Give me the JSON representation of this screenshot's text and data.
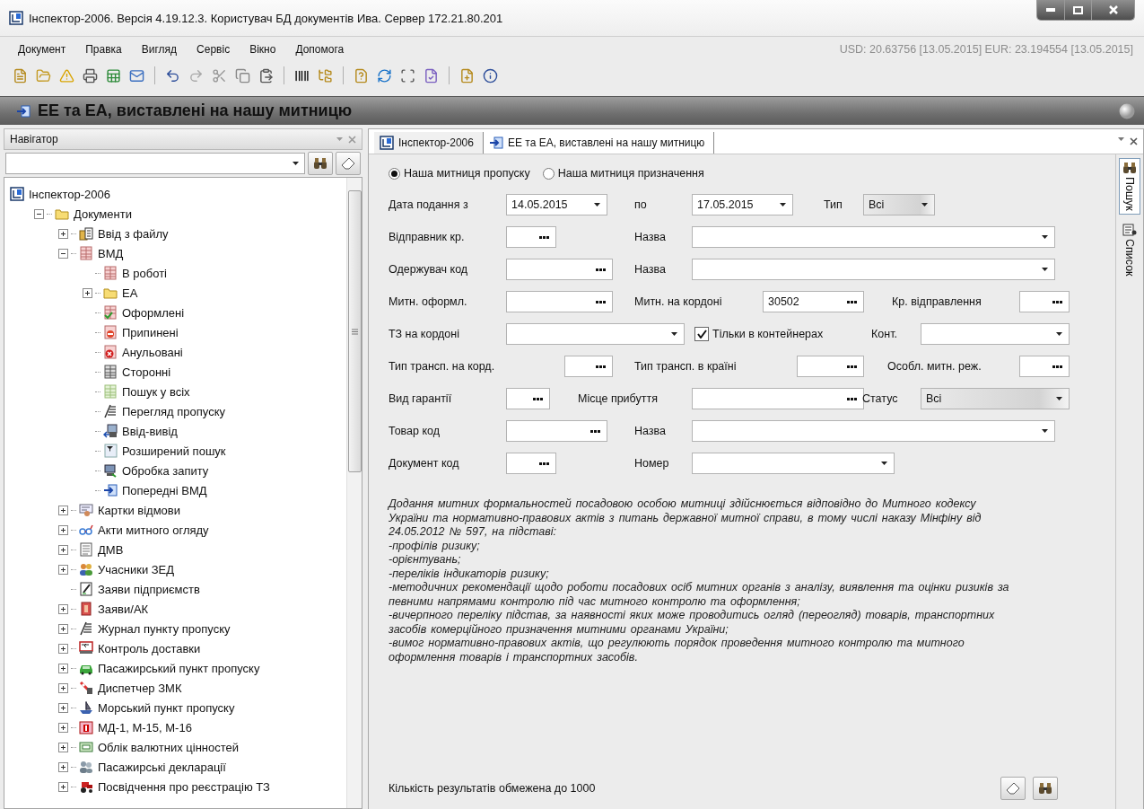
{
  "window": {
    "title": "Інспектор-2006. Версія 4.19.12.3. Користувач БД документів Ива. Сервер 172.21.80.201"
  },
  "menu": [
    "Документ",
    "Правка",
    "Вигляд",
    "Сервіс",
    "Вікно",
    "Допомога"
  ],
  "currency": "USD: 20.63756 [13.05.2015] EUR: 23.194554 [13.05.2015]",
  "page_title": "ЕЕ та ЕА, виставлені на нашу митницю",
  "navigator": {
    "title": "Навігатор",
    "tree": [
      {
        "label": "Інспектор-2006",
        "kind": "app",
        "children": [
          {
            "label": "Документи",
            "kind": "folder",
            "expanded": true,
            "children": [
              {
                "label": "Ввід з файлу",
                "kind": "import",
                "expanded": false
              },
              {
                "label": "ВМД",
                "kind": "table",
                "expanded": true,
                "children": [
                  {
                    "label": "В роботі",
                    "kind": "table"
                  },
                  {
                    "label": "ЕА",
                    "kind": "folder",
                    "expanded": false
                  },
                  {
                    "label": "Оформлені",
                    "kind": "table-check"
                  },
                  {
                    "label": "Припинені",
                    "kind": "table-stop"
                  },
                  {
                    "label": "Анульовані",
                    "kind": "table-cancel"
                  },
                  {
                    "label": "Сторонні",
                    "kind": "table-gray"
                  },
                  {
                    "label": "Пошук у всіх",
                    "kind": "table-green"
                  },
                  {
                    "label": "Перегляд пропуску",
                    "kind": "lines"
                  },
                  {
                    "label": "Ввід-вивід",
                    "kind": "io"
                  },
                  {
                    "label": "Розширений пошук",
                    "kind": "filter"
                  },
                  {
                    "label": "Обробка запиту",
                    "kind": "computer"
                  },
                  {
                    "label": "Попередні ВМД",
                    "kind": "arrow"
                  }
                ]
              },
              {
                "label": "Картки відмови",
                "kind": "card",
                "expanded": false
              },
              {
                "label": "Акти митного огляду",
                "kind": "glasses",
                "expanded": false
              },
              {
                "label": "ДМВ",
                "kind": "doc",
                "expanded": false
              },
              {
                "label": "Учасники ЗЕД",
                "kind": "people",
                "expanded": false
              },
              {
                "label": "Заяви підприємств",
                "kind": "doc-edit"
              },
              {
                "label": "Заяви/АК",
                "kind": "red-doc",
                "expanded": false
              },
              {
                "label": "Журнал пункту пропуску",
                "kind": "lines",
                "expanded": false
              },
              {
                "label": "Контроль доставки",
                "kind": "truck",
                "expanded": false
              },
              {
                "label": "Пасажирський пункт пропуску",
                "kind": "car",
                "expanded": false
              },
              {
                "label": "Диспетчер ЗМК",
                "kind": "barrier",
                "expanded": false
              },
              {
                "label": "Морський пункт пропуску",
                "kind": "ship",
                "expanded": false
              },
              {
                "label": "МД-1, М-15, М-16",
                "kind": "calendar",
                "expanded": false
              },
              {
                "label": "Облік валютних цінностей",
                "kind": "money",
                "expanded": false
              },
              {
                "label": "Пасажирські декларації",
                "kind": "people-gray",
                "expanded": false
              },
              {
                "label": "Посвідчення про реєстрацію ТЗ",
                "kind": "tractor",
                "expanded": false
              }
            ]
          }
        ]
      }
    ]
  },
  "tabs": [
    {
      "label": "Інспектор-2006",
      "kind": "app",
      "selected": false
    },
    {
      "label": "ЕЕ та ЕА, виставлені на нашу митницю",
      "kind": "arrow",
      "selected": true
    }
  ],
  "form": {
    "radios": [
      {
        "label": "Наша митниця пропуску",
        "selected": true
      },
      {
        "label": "Наша митниця призначення",
        "selected": false
      }
    ],
    "rows": [
      {
        "items": [
          {
            "kind": "label",
            "text": "Дата подання з"
          },
          {
            "kind": "date",
            "value": "14.05.2015"
          },
          {
            "kind": "label",
            "text": "по"
          },
          {
            "kind": "date",
            "value": "17.05.2015"
          },
          {
            "kind": "label",
            "text": "Тип"
          },
          {
            "kind": "select",
            "value": "Всі"
          }
        ]
      },
      {
        "items": [
          {
            "kind": "label",
            "text": "Відправник кр."
          },
          {
            "kind": "lookup"
          },
          {
            "kind": "label",
            "text": "Назва"
          },
          {
            "kind": "combo"
          }
        ]
      },
      {
        "items": [
          {
            "kind": "label",
            "text": "Одержувач код"
          },
          {
            "kind": "lookup"
          },
          {
            "kind": "label",
            "text": "Назва"
          },
          {
            "kind": "combo"
          }
        ]
      },
      {
        "items": [
          {
            "kind": "label",
            "text": "Митн. оформл."
          },
          {
            "kind": "lookup"
          },
          {
            "kind": "label",
            "text": "Митн. на кордоні"
          },
          {
            "kind": "lookup",
            "value": "30502"
          },
          {
            "kind": "label",
            "text": "Кр. відправлення"
          },
          {
            "kind": "lookup"
          }
        ]
      },
      {
        "items": [
          {
            "kind": "label",
            "text": "ТЗ на кордоні"
          },
          {
            "kind": "combo"
          },
          {
            "kind": "checkbox",
            "text": "Тільки в контейнерах",
            "checked": true
          },
          {
            "kind": "label",
            "text": "Конт."
          },
          {
            "kind": "combo"
          }
        ]
      },
      {
        "items": [
          {
            "kind": "label",
            "text": "Тип трансп. на корд."
          },
          {
            "kind": "lookup"
          },
          {
            "kind": "label",
            "text": "Тип трансп. в країні"
          },
          {
            "kind": "lookup"
          },
          {
            "kind": "label",
            "text": "Особл. митн. реж."
          },
          {
            "kind": "lookup"
          }
        ]
      },
      {
        "items": [
          {
            "kind": "label",
            "text": "Вид гарантії"
          },
          {
            "kind": "lookup"
          },
          {
            "kind": "label",
            "text": "Місце прибуття"
          },
          {
            "kind": "lookup"
          },
          {
            "kind": "label",
            "text": "Статус"
          },
          {
            "kind": "select",
            "value": "Всі"
          }
        ]
      },
      {
        "items": [
          {
            "kind": "label",
            "text": "Товар код"
          },
          {
            "kind": "lookup"
          },
          {
            "kind": "label",
            "text": "Назва"
          },
          {
            "kind": "combo"
          }
        ]
      },
      {
        "items": [
          {
            "kind": "label",
            "text": "Документ код"
          },
          {
            "kind": "lookup"
          },
          {
            "kind": "label",
            "text": "Номер"
          },
          {
            "kind": "combo"
          }
        ]
      }
    ],
    "notice": {
      "intro": "Додання митних формальностей посадовою особою митниці здійснюється відповідно до Митного кодексу України та нормативно-правових актів з питань державної митної справи, в тому числі наказу Мінфіну від 24.05.2012 № 597, на підставі:",
      "items": [
        "-профілів ризику;",
        "-орієнтувань;",
        "-переліків індикаторів ризику;",
        "-методичних рекомендації щодо роботи посадових осіб митних органів з аналізу, виявлення та оцінки ризиків за певними напрямами контролю під час митного контролю та оформлення;",
        "-вичерпного переліку підстав, за наявності яких може проводитись огляд (переогляд) товарів, транспортних засобів комерційного призначення митними органами України;",
        "-вимог нормативно-правових актів, що регулюють порядок проведення митного контролю та митного оформлення товарів і транспортних засобів."
      ]
    },
    "limit_note": "Кількість результатів обмежена до 1000"
  },
  "side_tabs": [
    {
      "label": "Пошук",
      "kind": "search",
      "selected": true
    },
    {
      "label": "Список",
      "kind": "list",
      "selected": false
    }
  ]
}
